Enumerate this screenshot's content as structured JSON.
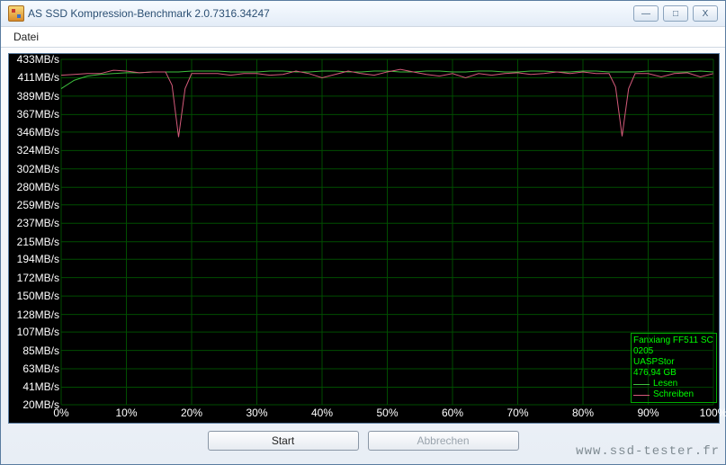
{
  "window": {
    "title": "AS SSD Kompression-Benchmark 2.0.7316.34247",
    "btn_min": "—",
    "btn_max": "□",
    "btn_close": "X"
  },
  "menu": {
    "file": "Datei"
  },
  "buttons": {
    "start": "Start",
    "cancel": "Abbrechen"
  },
  "legend": {
    "device": "Fanxiang FF511 SC",
    "firmware": "0205",
    "driver": "UASPStor",
    "capacity": "476,94 GB",
    "read": "Lesen",
    "write": "Schreiben"
  },
  "watermark": "www.ssd-tester.fr",
  "chart_data": {
    "type": "line",
    "xlabel": "",
    "ylabel": "MB/s",
    "xlim": [
      0,
      100
    ],
    "ylim": [
      20,
      433
    ],
    "x_ticks": [
      "0%",
      "10%",
      "20%",
      "30%",
      "40%",
      "50%",
      "60%",
      "70%",
      "80%",
      "90%",
      "100%"
    ],
    "y_ticks": [
      "433MB/s",
      "411MB/s",
      "389MB/s",
      "367MB/s",
      "346MB/s",
      "324MB/s",
      "302MB/s",
      "280MB/s",
      "259MB/s",
      "237MB/s",
      "215MB/s",
      "194MB/s",
      "172MB/s",
      "150MB/s",
      "128MB/s",
      "107MB/s",
      "85MB/s",
      "63MB/s",
      "41MB/s",
      "20MB/s"
    ],
    "series": [
      {
        "name": "Lesen",
        "color": "#3dbf3d",
        "x": [
          0,
          2,
          4,
          6,
          8,
          10,
          12,
          14,
          16,
          18,
          20,
          22,
          24,
          26,
          28,
          30,
          32,
          34,
          36,
          38,
          40,
          42,
          44,
          46,
          48,
          50,
          52,
          54,
          56,
          58,
          60,
          62,
          64,
          66,
          68,
          70,
          72,
          74,
          76,
          78,
          80,
          82,
          84,
          86,
          88,
          90,
          92,
          94,
          96,
          98,
          100
        ],
        "values": [
          398,
          408,
          413,
          415,
          416,
          417,
          417,
          418,
          418,
          418,
          419,
          419,
          419,
          418,
          418,
          418,
          419,
          419,
          418,
          418,
          419,
          419,
          418,
          418,
          419,
          419,
          418,
          418,
          419,
          419,
          418,
          418,
          419,
          419,
          418,
          418,
          419,
          419,
          418,
          418,
          419,
          419,
          418,
          418,
          418,
          419,
          419,
          418,
          418,
          419,
          418
        ]
      },
      {
        "name": "Schreiben",
        "color": "#d45a7a",
        "x": [
          0,
          2,
          4,
          6,
          8,
          10,
          12,
          14,
          16,
          17,
          18,
          19,
          20,
          22,
          24,
          26,
          28,
          30,
          32,
          34,
          36,
          38,
          40,
          42,
          44,
          46,
          48,
          50,
          52,
          54,
          56,
          58,
          60,
          62,
          64,
          66,
          68,
          70,
          72,
          74,
          76,
          78,
          80,
          82,
          84,
          85,
          86,
          87,
          88,
          90,
          92,
          94,
          96,
          98,
          100
        ],
        "values": [
          414,
          415,
          416,
          416,
          420,
          419,
          417,
          418,
          418,
          402,
          340,
          398,
          416,
          416,
          416,
          414,
          416,
          416,
          414,
          415,
          419,
          416,
          411,
          415,
          419,
          416,
          414,
          418,
          421,
          418,
          415,
          413,
          416,
          411,
          416,
          414,
          416,
          417,
          415,
          416,
          418,
          416,
          418,
          416,
          416,
          400,
          341,
          398,
          416,
          416,
          412,
          416,
          417,
          412,
          416
        ]
      }
    ]
  }
}
